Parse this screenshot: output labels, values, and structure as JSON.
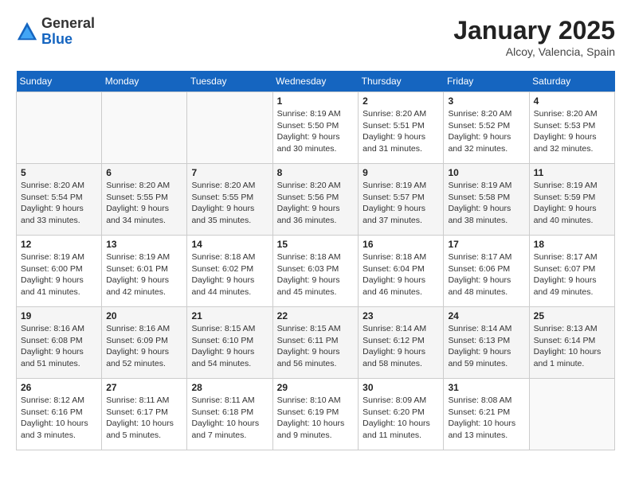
{
  "header": {
    "logo_general": "General",
    "logo_blue": "Blue",
    "month": "January 2025",
    "location": "Alcoy, Valencia, Spain"
  },
  "days_of_week": [
    "Sunday",
    "Monday",
    "Tuesday",
    "Wednesday",
    "Thursday",
    "Friday",
    "Saturday"
  ],
  "weeks": [
    [
      {
        "day": "",
        "info": ""
      },
      {
        "day": "",
        "info": ""
      },
      {
        "day": "",
        "info": ""
      },
      {
        "day": "1",
        "info": "Sunrise: 8:19 AM\nSunset: 5:50 PM\nDaylight: 9 hours\nand 30 minutes."
      },
      {
        "day": "2",
        "info": "Sunrise: 8:20 AM\nSunset: 5:51 PM\nDaylight: 9 hours\nand 31 minutes."
      },
      {
        "day": "3",
        "info": "Sunrise: 8:20 AM\nSunset: 5:52 PM\nDaylight: 9 hours\nand 32 minutes."
      },
      {
        "day": "4",
        "info": "Sunrise: 8:20 AM\nSunset: 5:53 PM\nDaylight: 9 hours\nand 32 minutes."
      }
    ],
    [
      {
        "day": "5",
        "info": "Sunrise: 8:20 AM\nSunset: 5:54 PM\nDaylight: 9 hours\nand 33 minutes."
      },
      {
        "day": "6",
        "info": "Sunrise: 8:20 AM\nSunset: 5:55 PM\nDaylight: 9 hours\nand 34 minutes."
      },
      {
        "day": "7",
        "info": "Sunrise: 8:20 AM\nSunset: 5:55 PM\nDaylight: 9 hours\nand 35 minutes."
      },
      {
        "day": "8",
        "info": "Sunrise: 8:20 AM\nSunset: 5:56 PM\nDaylight: 9 hours\nand 36 minutes."
      },
      {
        "day": "9",
        "info": "Sunrise: 8:19 AM\nSunset: 5:57 PM\nDaylight: 9 hours\nand 37 minutes."
      },
      {
        "day": "10",
        "info": "Sunrise: 8:19 AM\nSunset: 5:58 PM\nDaylight: 9 hours\nand 38 minutes."
      },
      {
        "day": "11",
        "info": "Sunrise: 8:19 AM\nSunset: 5:59 PM\nDaylight: 9 hours\nand 40 minutes."
      }
    ],
    [
      {
        "day": "12",
        "info": "Sunrise: 8:19 AM\nSunset: 6:00 PM\nDaylight: 9 hours\nand 41 minutes."
      },
      {
        "day": "13",
        "info": "Sunrise: 8:19 AM\nSunset: 6:01 PM\nDaylight: 9 hours\nand 42 minutes."
      },
      {
        "day": "14",
        "info": "Sunrise: 8:18 AM\nSunset: 6:02 PM\nDaylight: 9 hours\nand 44 minutes."
      },
      {
        "day": "15",
        "info": "Sunrise: 8:18 AM\nSunset: 6:03 PM\nDaylight: 9 hours\nand 45 minutes."
      },
      {
        "day": "16",
        "info": "Sunrise: 8:18 AM\nSunset: 6:04 PM\nDaylight: 9 hours\nand 46 minutes."
      },
      {
        "day": "17",
        "info": "Sunrise: 8:17 AM\nSunset: 6:06 PM\nDaylight: 9 hours\nand 48 minutes."
      },
      {
        "day": "18",
        "info": "Sunrise: 8:17 AM\nSunset: 6:07 PM\nDaylight: 9 hours\nand 49 minutes."
      }
    ],
    [
      {
        "day": "19",
        "info": "Sunrise: 8:16 AM\nSunset: 6:08 PM\nDaylight: 9 hours\nand 51 minutes."
      },
      {
        "day": "20",
        "info": "Sunrise: 8:16 AM\nSunset: 6:09 PM\nDaylight: 9 hours\nand 52 minutes."
      },
      {
        "day": "21",
        "info": "Sunrise: 8:15 AM\nSunset: 6:10 PM\nDaylight: 9 hours\nand 54 minutes."
      },
      {
        "day": "22",
        "info": "Sunrise: 8:15 AM\nSunset: 6:11 PM\nDaylight: 9 hours\nand 56 minutes."
      },
      {
        "day": "23",
        "info": "Sunrise: 8:14 AM\nSunset: 6:12 PM\nDaylight: 9 hours\nand 58 minutes."
      },
      {
        "day": "24",
        "info": "Sunrise: 8:14 AM\nSunset: 6:13 PM\nDaylight: 9 hours\nand 59 minutes."
      },
      {
        "day": "25",
        "info": "Sunrise: 8:13 AM\nSunset: 6:14 PM\nDaylight: 10 hours\nand 1 minute."
      }
    ],
    [
      {
        "day": "26",
        "info": "Sunrise: 8:12 AM\nSunset: 6:16 PM\nDaylight: 10 hours\nand 3 minutes."
      },
      {
        "day": "27",
        "info": "Sunrise: 8:11 AM\nSunset: 6:17 PM\nDaylight: 10 hours\nand 5 minutes."
      },
      {
        "day": "28",
        "info": "Sunrise: 8:11 AM\nSunset: 6:18 PM\nDaylight: 10 hours\nand 7 minutes."
      },
      {
        "day": "29",
        "info": "Sunrise: 8:10 AM\nSunset: 6:19 PM\nDaylight: 10 hours\nand 9 minutes."
      },
      {
        "day": "30",
        "info": "Sunrise: 8:09 AM\nSunset: 6:20 PM\nDaylight: 10 hours\nand 11 minutes."
      },
      {
        "day": "31",
        "info": "Sunrise: 8:08 AM\nSunset: 6:21 PM\nDaylight: 10 hours\nand 13 minutes."
      },
      {
        "day": "",
        "info": ""
      }
    ]
  ]
}
